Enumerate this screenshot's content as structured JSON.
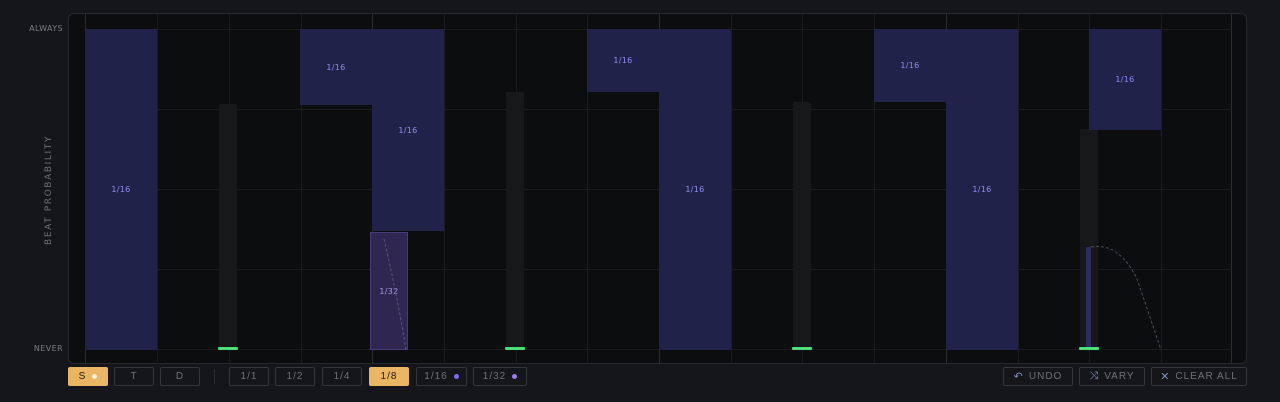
{
  "y_axis": {
    "top_label": "ALWAYS",
    "bottom_label": "NEVER",
    "title": "BEAT PROBABILITY"
  },
  "blocks": [
    {
      "label": "1/16"
    },
    {
      "label": "1/16"
    },
    {
      "label": "1/16"
    },
    {
      "label": "1/32"
    },
    {
      "label": "1/16"
    },
    {
      "label": "1/16"
    },
    {
      "label": "1/16"
    },
    {
      "label": "1/16"
    },
    {
      "label": "1/16"
    }
  ],
  "toolbar": {
    "modes": [
      {
        "label": "S",
        "active": true
      },
      {
        "label": "T",
        "active": false
      },
      {
        "label": "D",
        "active": false
      }
    ],
    "divisions": [
      {
        "label": "1/1",
        "active": false
      },
      {
        "label": "1/2",
        "active": false
      },
      {
        "label": "1/4",
        "active": false
      },
      {
        "label": "1/8",
        "active": true
      },
      {
        "label": "1/16",
        "active": false,
        "dot_color": "#7b6cf0"
      },
      {
        "label": "1/32",
        "active": false,
        "dot_color": "#9c7cf0"
      }
    ],
    "undo_label": "UNDO",
    "vary_label": "VARY",
    "clear_label": "CLEAR ALL"
  },
  "colors": {
    "accent_active": "#eab663",
    "block_fill": "#212249",
    "marker": "#4de07a"
  }
}
